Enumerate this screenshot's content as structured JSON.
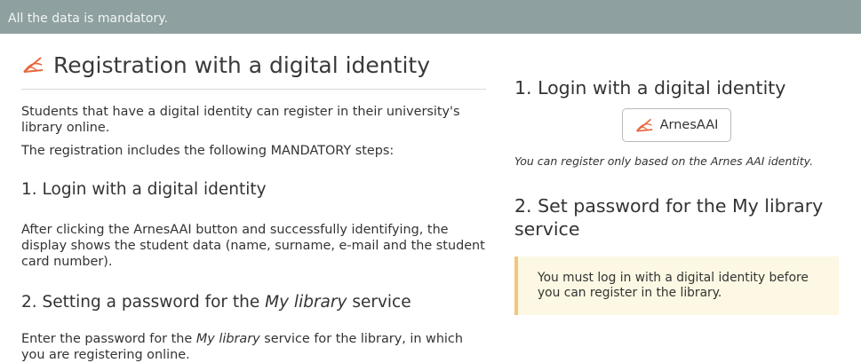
{
  "banner": {
    "text": "All the data is mandatory."
  },
  "left": {
    "title": "Registration with a digital identity",
    "intro": "Students that have a digital identity can register in their university's library online.",
    "steps_intro": "The registration includes the following MANDATORY steps:",
    "step1": {
      "heading": "1. Login with a digital identity",
      "body": "After clicking the ArnesAAI button and successfully identifying, the display shows the student data (name, surname, e-mail and the student card number)."
    },
    "step2": {
      "heading_prefix": "2. Setting a password for the ",
      "heading_em": "My library",
      "heading_suffix": " service",
      "body_prefix": "Enter the password for the ",
      "body_em": "My library",
      "body_suffix": " service for the library, in which you are registering online."
    }
  },
  "right": {
    "login_heading": "1. Login with a digital identity",
    "button_label": "ArnesAAI",
    "note": "You can register only based on the Arnes AAI identity.",
    "password_heading": "2. Set password for the My library service",
    "alert_text": "You must log in with a digital identity before you can register in the library."
  },
  "icons": {
    "logo": "arnes-aai-logo-icon"
  },
  "colors": {
    "banner_bg": "#8ea09f",
    "accent": "#e8663d",
    "alert_bg": "#fcf8e3",
    "alert_border": "#f0c77c"
  }
}
